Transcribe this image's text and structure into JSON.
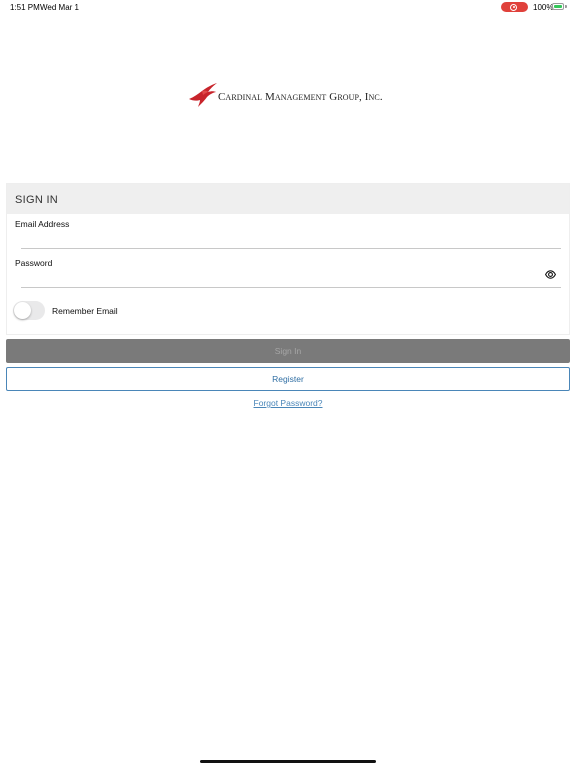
{
  "status_bar": {
    "time": "1:51 PM",
    "date": "Wed Mar 1",
    "battery_percent": "100%",
    "battery_level": 1.0,
    "recording_color": "#e0413b"
  },
  "logo": {
    "text": "Cardinal Management Group, Inc.",
    "icon": "cardinal-bird-icon",
    "accent_color": "#c8242b"
  },
  "signin": {
    "header": "SIGN IN",
    "email_label": "Email Address",
    "email_value": "",
    "password_label": "Password",
    "password_value": "",
    "password_toggle_icon": "eye-icon",
    "remember_label": "Remember Email",
    "remember_on": false
  },
  "buttons": {
    "signin_label": "Sign In",
    "register_label": "Register",
    "forgot_label": "Forgot Password?"
  },
  "colors": {
    "signin_button_bg": "#7a7a7a",
    "register_border": "#4a86b8",
    "link": "#4a86b8"
  }
}
